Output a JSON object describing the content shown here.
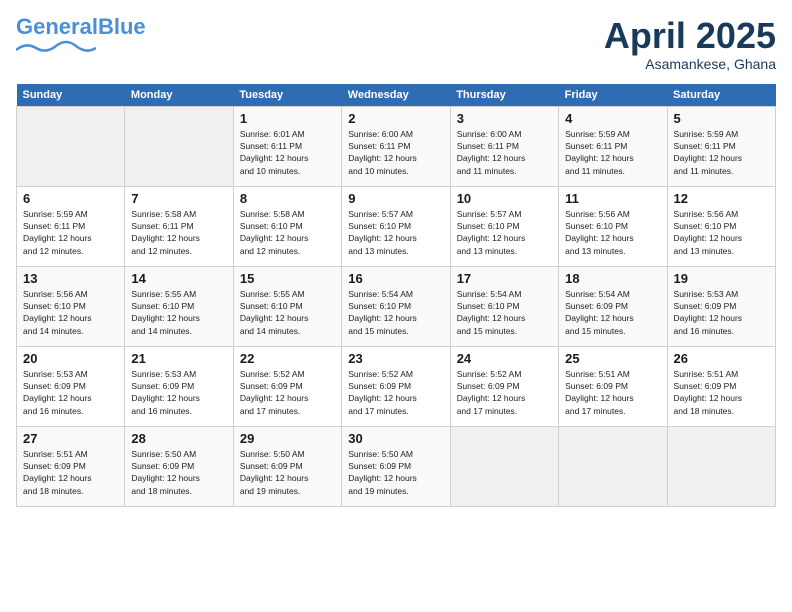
{
  "header": {
    "logo_main": "General",
    "logo_accent": "Blue",
    "month": "April 2025",
    "location": "Asamankese, Ghana"
  },
  "days_of_week": [
    "Sunday",
    "Monday",
    "Tuesday",
    "Wednesday",
    "Thursday",
    "Friday",
    "Saturday"
  ],
  "weeks": [
    [
      {
        "day": "",
        "info": ""
      },
      {
        "day": "",
        "info": ""
      },
      {
        "day": "1",
        "info": "Sunrise: 6:01 AM\nSunset: 6:11 PM\nDaylight: 12 hours\nand 10 minutes."
      },
      {
        "day": "2",
        "info": "Sunrise: 6:00 AM\nSunset: 6:11 PM\nDaylight: 12 hours\nand 10 minutes."
      },
      {
        "day": "3",
        "info": "Sunrise: 6:00 AM\nSunset: 6:11 PM\nDaylight: 12 hours\nand 11 minutes."
      },
      {
        "day": "4",
        "info": "Sunrise: 5:59 AM\nSunset: 6:11 PM\nDaylight: 12 hours\nand 11 minutes."
      },
      {
        "day": "5",
        "info": "Sunrise: 5:59 AM\nSunset: 6:11 PM\nDaylight: 12 hours\nand 11 minutes."
      }
    ],
    [
      {
        "day": "6",
        "info": "Sunrise: 5:59 AM\nSunset: 6:11 PM\nDaylight: 12 hours\nand 12 minutes."
      },
      {
        "day": "7",
        "info": "Sunrise: 5:58 AM\nSunset: 6:11 PM\nDaylight: 12 hours\nand 12 minutes."
      },
      {
        "day": "8",
        "info": "Sunrise: 5:58 AM\nSunset: 6:10 PM\nDaylight: 12 hours\nand 12 minutes."
      },
      {
        "day": "9",
        "info": "Sunrise: 5:57 AM\nSunset: 6:10 PM\nDaylight: 12 hours\nand 13 minutes."
      },
      {
        "day": "10",
        "info": "Sunrise: 5:57 AM\nSunset: 6:10 PM\nDaylight: 12 hours\nand 13 minutes."
      },
      {
        "day": "11",
        "info": "Sunrise: 5:56 AM\nSunset: 6:10 PM\nDaylight: 12 hours\nand 13 minutes."
      },
      {
        "day": "12",
        "info": "Sunrise: 5:56 AM\nSunset: 6:10 PM\nDaylight: 12 hours\nand 13 minutes."
      }
    ],
    [
      {
        "day": "13",
        "info": "Sunrise: 5:56 AM\nSunset: 6:10 PM\nDaylight: 12 hours\nand 14 minutes."
      },
      {
        "day": "14",
        "info": "Sunrise: 5:55 AM\nSunset: 6:10 PM\nDaylight: 12 hours\nand 14 minutes."
      },
      {
        "day": "15",
        "info": "Sunrise: 5:55 AM\nSunset: 6:10 PM\nDaylight: 12 hours\nand 14 minutes."
      },
      {
        "day": "16",
        "info": "Sunrise: 5:54 AM\nSunset: 6:10 PM\nDaylight: 12 hours\nand 15 minutes."
      },
      {
        "day": "17",
        "info": "Sunrise: 5:54 AM\nSunset: 6:10 PM\nDaylight: 12 hours\nand 15 minutes."
      },
      {
        "day": "18",
        "info": "Sunrise: 5:54 AM\nSunset: 6:09 PM\nDaylight: 12 hours\nand 15 minutes."
      },
      {
        "day": "19",
        "info": "Sunrise: 5:53 AM\nSunset: 6:09 PM\nDaylight: 12 hours\nand 16 minutes."
      }
    ],
    [
      {
        "day": "20",
        "info": "Sunrise: 5:53 AM\nSunset: 6:09 PM\nDaylight: 12 hours\nand 16 minutes."
      },
      {
        "day": "21",
        "info": "Sunrise: 5:53 AM\nSunset: 6:09 PM\nDaylight: 12 hours\nand 16 minutes."
      },
      {
        "day": "22",
        "info": "Sunrise: 5:52 AM\nSunset: 6:09 PM\nDaylight: 12 hours\nand 17 minutes."
      },
      {
        "day": "23",
        "info": "Sunrise: 5:52 AM\nSunset: 6:09 PM\nDaylight: 12 hours\nand 17 minutes."
      },
      {
        "day": "24",
        "info": "Sunrise: 5:52 AM\nSunset: 6:09 PM\nDaylight: 12 hours\nand 17 minutes."
      },
      {
        "day": "25",
        "info": "Sunrise: 5:51 AM\nSunset: 6:09 PM\nDaylight: 12 hours\nand 17 minutes."
      },
      {
        "day": "26",
        "info": "Sunrise: 5:51 AM\nSunset: 6:09 PM\nDaylight: 12 hours\nand 18 minutes."
      }
    ],
    [
      {
        "day": "27",
        "info": "Sunrise: 5:51 AM\nSunset: 6:09 PM\nDaylight: 12 hours\nand 18 minutes."
      },
      {
        "day": "28",
        "info": "Sunrise: 5:50 AM\nSunset: 6:09 PM\nDaylight: 12 hours\nand 18 minutes."
      },
      {
        "day": "29",
        "info": "Sunrise: 5:50 AM\nSunset: 6:09 PM\nDaylight: 12 hours\nand 19 minutes."
      },
      {
        "day": "30",
        "info": "Sunrise: 5:50 AM\nSunset: 6:09 PM\nDaylight: 12 hours\nand 19 minutes."
      },
      {
        "day": "",
        "info": ""
      },
      {
        "day": "",
        "info": ""
      },
      {
        "day": "",
        "info": ""
      }
    ]
  ]
}
